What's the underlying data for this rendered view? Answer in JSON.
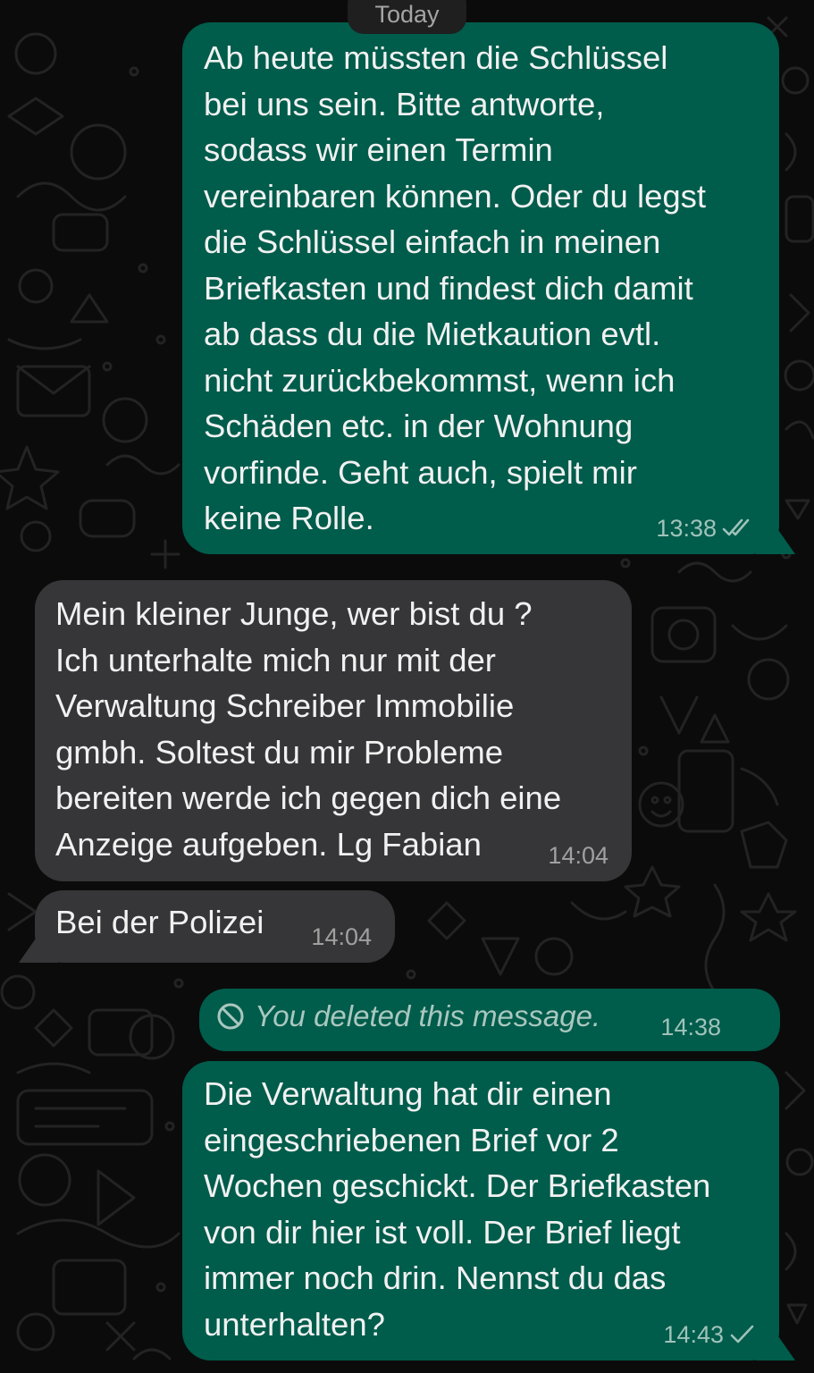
{
  "date_separator": "Today",
  "messages": [
    {
      "direction": "outgoing",
      "text": "Ab heute müssten die Schlüssel\nbei uns sein. Bitte antworte,\nsodass wir einen Termin\nvereinbaren können. Oder du legst\ndie Schlüssel einfach in meinen\nBriefkasten und findest dich damit\nab dass du die Mietkaution evtl.\nnicht zurückbekommst, wenn ich\nSchäden etc. in der Wohnung\nvorfinde. Geht auch, spielt mir\nkeine Rolle.",
      "time": "13:38",
      "status": "read-double-check-icon"
    },
    {
      "direction": "incoming",
      "text": "Mein kleiner Junge, wer bist du ?\nIch unterhalte mich nur mit der\nVerwaltung Schreiber Immobilie\ngmbh. Soltest du mir Probleme\nbereiten werde ich gegen dich eine\nAnzeige aufgeben. Lg Fabian",
      "time": "14:04"
    },
    {
      "direction": "incoming",
      "text": "Bei der Polizei",
      "time": "14:04"
    },
    {
      "direction": "outgoing",
      "deleted": true,
      "text": "You deleted this message.",
      "time": "14:38",
      "icon": "deleted-ban-icon"
    },
    {
      "direction": "outgoing",
      "text": "Die Verwaltung hat dir einen\neingeschriebenen Brief vor 2\nWochen geschickt. Der Briefkasten\nvon dir hier ist voll. Der Brief liegt\nimmer noch drin. Nennst du das\nunterhalten?",
      "time": "14:43",
      "status": "sent-single-check-icon"
    }
  ],
  "colors": {
    "background": "#0b0b0b",
    "outgoing_bubble": "#005c4b",
    "incoming_bubble": "#363638",
    "date_pill": "#1f1f1f"
  }
}
